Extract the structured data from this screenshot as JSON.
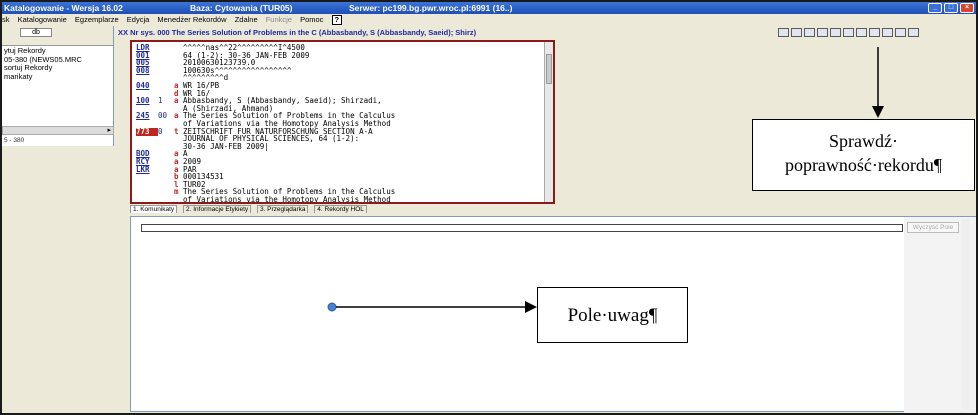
{
  "window": {
    "title_app": "Katalogowanie - Wersja 16.02",
    "title_db": "Baza: Cytowania (TUR05)",
    "title_server": "Serwer: pc199.bg.pwr.wroc.pl:6991 (16..)"
  },
  "menu": {
    "items": [
      "sk",
      "Katalogowanie",
      "Egzemplarze",
      "Edycja",
      "Menedżer Rekordów",
      "Zdalne",
      "Funkcje",
      "Pomoc"
    ],
    "help": "?"
  },
  "left_panel": {
    "tab_label": "db",
    "items": [
      "ytuj Rekordy",
      "05-380 (NEWS05.MRC",
      "sortuj Rekordy",
      "marikaty"
    ],
    "status": "5 - 380"
  },
  "record_header": "XX Nr sys. 000 The Series Solution of Problems in the C (Abbasbandy, S (Abbasbandy, Saeid); Shirz)",
  "toolbar_icons": [
    "save-icon",
    "tag-icon",
    "record-icon",
    "copy-icon",
    "check-icon",
    "view-icon",
    "attach-icon",
    "format-icon",
    "print-icon",
    "help-icon",
    "export-icon"
  ],
  "record": [
    {
      "tag": "LDR",
      "ind": "",
      "sub": "",
      "text": "^^^^^nas^^22^^^^^^^^^I^4500"
    },
    {
      "tag": "001",
      "ind": "",
      "sub": "",
      "text": "64 (1-2): 30-36 JAN-FEB 2009"
    },
    {
      "tag": "005",
      "ind": "",
      "sub": "",
      "text": "20100630123739.0"
    },
    {
      "tag": "008",
      "ind": "",
      "sub": "",
      "text": "100630s^^^^^^^^^^^^^^^^^"
    },
    {
      "tag": "",
      "ind": "",
      "sub": "",
      "text": "^^^^^^^^^d"
    },
    {
      "tag": "040",
      "ind": "",
      "sub": "a",
      "text": "WR 16/PB"
    },
    {
      "tag": "",
      "ind": "",
      "sub": "d",
      "text": "WR 16/"
    },
    {
      "tag": "100",
      "ind": "1",
      "sub": "a",
      "text": "Abbasbandy, S (Abbasbandy, Saeid); Shirzadi,"
    },
    {
      "tag": "",
      "ind": "",
      "sub": "",
      "text": "A (Shirzadi, Ahmand)"
    },
    {
      "tag": "245",
      "ind": "00",
      "sub": "a",
      "text": "The Series Solution of Problems in the Calculus"
    },
    {
      "tag": "",
      "ind": "",
      "sub": "",
      "text": "of Variations via the Homotopy Analysis Method"
    },
    {
      "tag": "773",
      "ind": "0",
      "sub": "t",
      "text": "ZEITSCHRIFT FUR NATURFORSCHUNG SECTION A-A"
    },
    {
      "tag": "",
      "ind": "",
      "sub": "",
      "text": "JOURNAL OF PHYSICAL SCIENCES, 64 (1-2):"
    },
    {
      "tag": "",
      "ind": "",
      "sub": "",
      "text": "30-36 JAN-FEB 2009|"
    },
    {
      "tag": "BOD",
      "ind": "",
      "sub": "a",
      "text": "A"
    },
    {
      "tag": "RCY",
      "ind": "",
      "sub": "a",
      "text": "2009"
    },
    {
      "tag": "LKR",
      "ind": "",
      "sub": "a",
      "text": "PAR"
    },
    {
      "tag": "",
      "ind": "",
      "sub": "b",
      "text": "000134531"
    },
    {
      "tag": "",
      "ind": "",
      "sub": "l",
      "text": "TUR02"
    },
    {
      "tag": "",
      "ind": "",
      "sub": "m",
      "text": "The Series Solution of Problems in the Calculus"
    },
    {
      "tag": "",
      "ind": "",
      "sub": "",
      "text": "of Variations via the Homotopy Analysis Method"
    }
  ],
  "tabs": [
    "1. Komunikaty",
    "2. Informacje Etykiety",
    "3. Przeglądarka",
    "4. Rekordy HOL"
  ],
  "notes_button": "Wyczyść Pole",
  "callouts": {
    "check_record": [
      "Sprawdź·",
      "poprawność·rekordu¶"
    ],
    "notes_field": "Pole·uwag¶"
  }
}
